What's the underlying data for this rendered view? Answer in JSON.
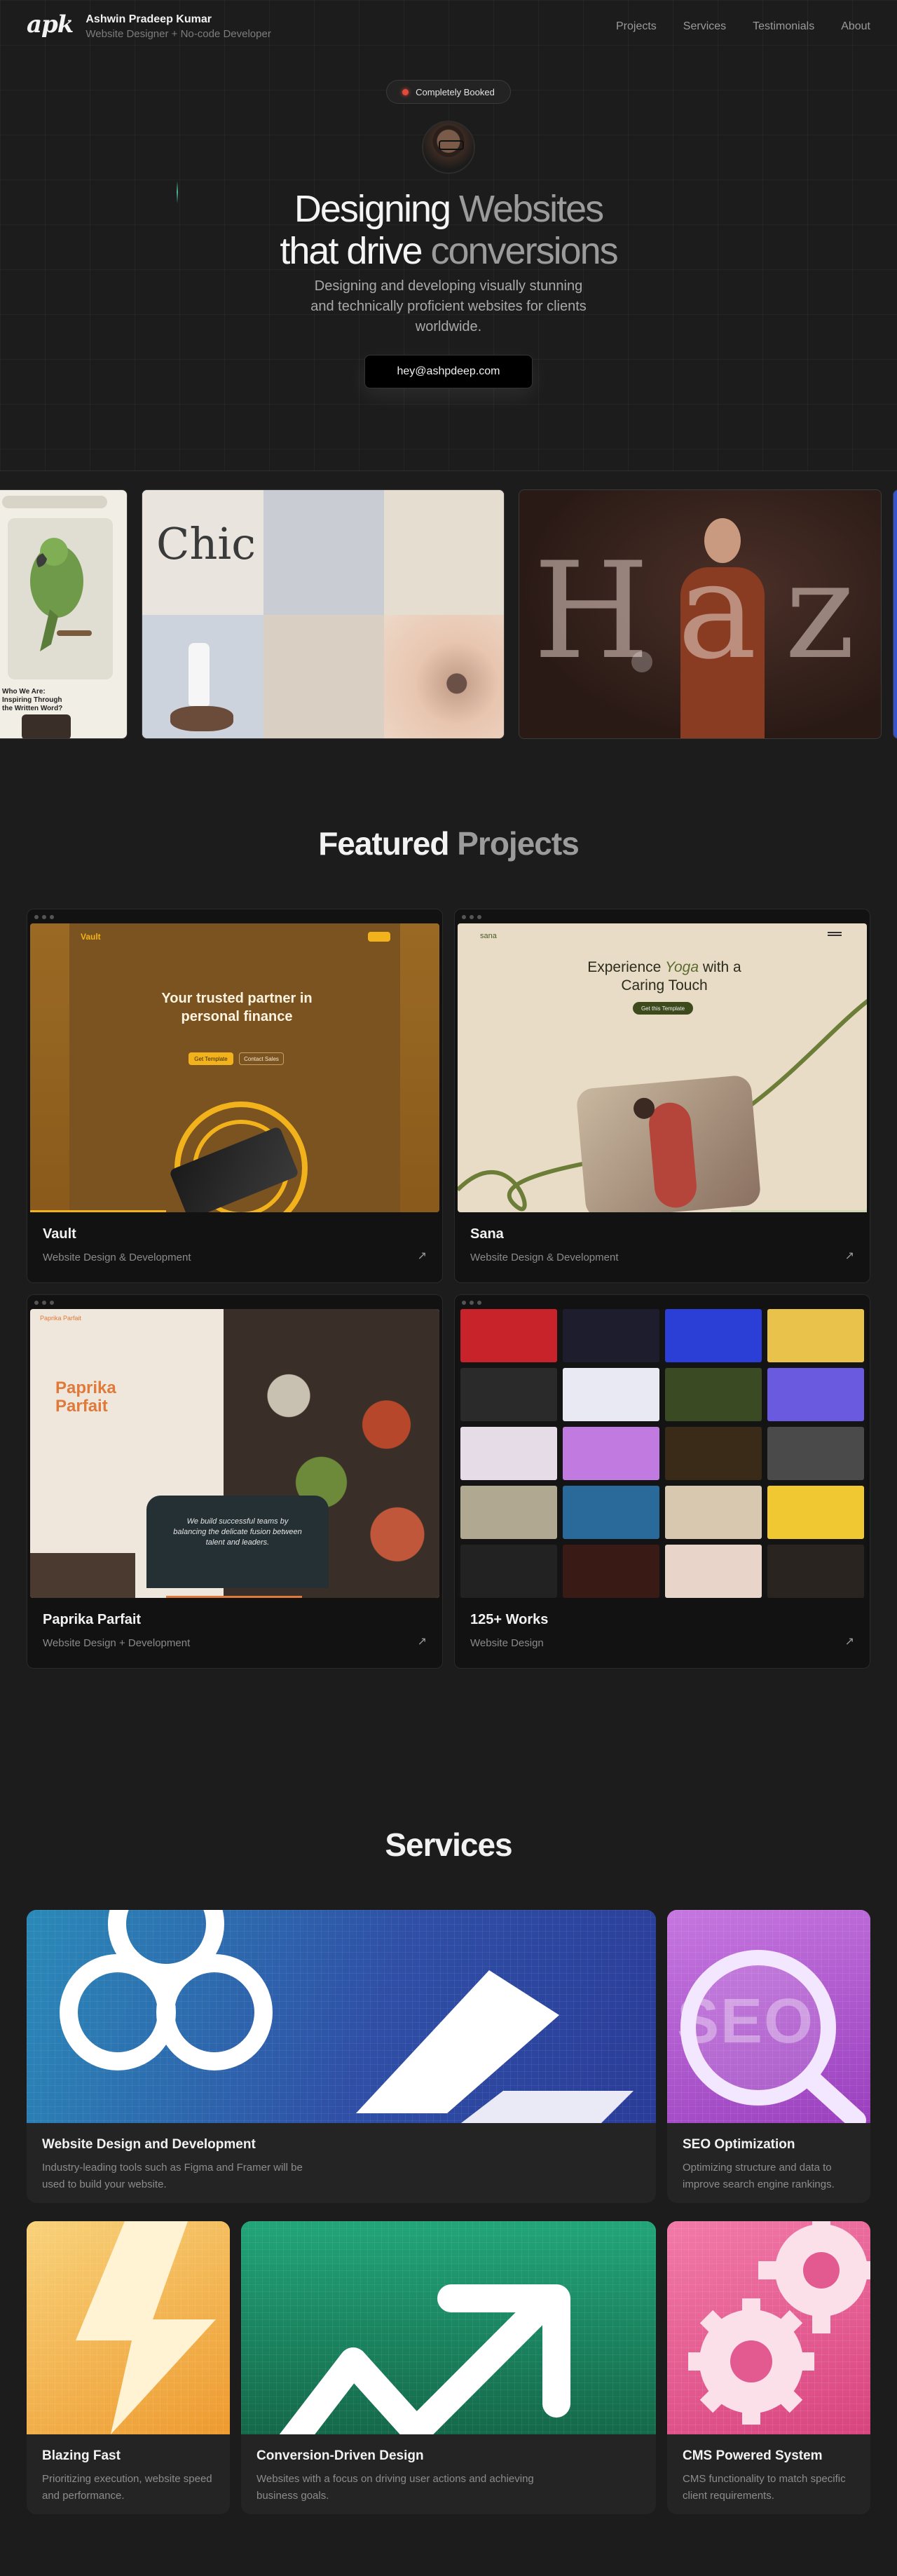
{
  "header": {
    "logo": "apk",
    "name": "Ashwin Pradeep Kumar",
    "role": "Website Designer + No-code Developer",
    "nav": [
      "Projects",
      "Services",
      "Testimonials",
      "About"
    ]
  },
  "hero": {
    "badge": "Completely Booked",
    "title_line1_a": "Designing ",
    "title_line1_b": "Websites",
    "title_line2_a": "that drive ",
    "title_line2_b": "conversions",
    "subtitle": "Designing and developing visually stunning and technically proficient websites for clients worldwide.",
    "cta": "hey@ashpdeep.com"
  },
  "showcase": {
    "shot1_title": "Who We Are: Inspiring Through the Written Word?",
    "shot2_title": "Chic",
    "shot3_title": "Hazel"
  },
  "projects": {
    "heading_a": "Featured ",
    "heading_b": "Projects",
    "items": [
      {
        "title": "Vault",
        "desc": "Website Design & Development",
        "preview_headline": "Your trusted partner in personal finance",
        "preview_brand": "Vault",
        "preview_btn1": "Get Template",
        "preview_btn2": "Contact Sales"
      },
      {
        "title": "Sana",
        "desc": "Website Design & Development",
        "preview_headline_a": "Experience ",
        "preview_headline_b": "Yoga",
        "preview_headline_c": " with a Caring Touch",
        "preview_brand": "sana",
        "preview_btn": "Get this Template"
      },
      {
        "title": "Paprika Parfait",
        "desc": "Website Design + Development",
        "preview_brand": "Paprika Parfait",
        "preview_heading": "Paprika Parfait",
        "preview_quote": "We build successful teams by balancing the delicate fusion between talent and leaders."
      },
      {
        "title": "125+ Works",
        "desc": "Website Design"
      }
    ],
    "arrow": "↗"
  },
  "services": {
    "heading": "Services",
    "items": [
      {
        "title": "Website Design and Development",
        "desc": "Industry-leading tools such as Figma and Framer will be used to build your website."
      },
      {
        "title": "SEO Optimization",
        "desc": "Optimizing structure and data to improve search engine rankings.",
        "art_text": "SEO"
      },
      {
        "title": "Blazing Fast",
        "desc": "Prioritizing execution, website speed and performance."
      },
      {
        "title": "Conversion-Driven Design",
        "desc": "Websites with a focus on driving user actions and achieving business goals."
      },
      {
        "title": "CMS Powered System",
        "desc": "CMS functionality to match specific client requirements."
      }
    ]
  },
  "colors": {
    "background": "#1c1c1c",
    "badge_dot": "#e14b3b",
    "vault_gold": "#f2b21b",
    "sana_green": "#5a6b2e",
    "paprika_orange": "#e07a3a"
  }
}
